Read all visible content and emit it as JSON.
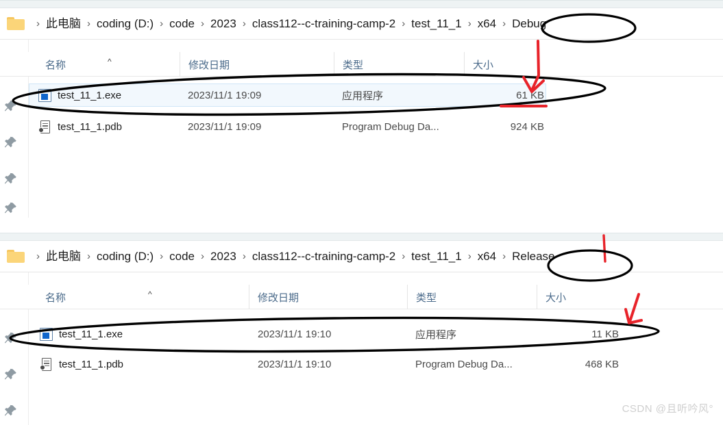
{
  "watermark": "CSDN @且听吟风°",
  "columns": {
    "name": "名称",
    "date": "修改日期",
    "type": "类型",
    "size": "大小"
  },
  "icons": {
    "folder": "folder-icon",
    "chevron": "chevron-right-icon",
    "sort_caret": "sort-ascending-caret-icon",
    "pin": "pin-icon",
    "exe": "application-exe-icon",
    "pdb": "program-debug-database-icon"
  },
  "colors": {
    "annotation_black": "#000000",
    "annotation_red": "#e8232a",
    "selection_blue": "#f2f8fd",
    "header_text": "#4a6a8a",
    "breadcrumb_text": "#1b1b1b"
  },
  "panels": [
    {
      "id": "debug-panel",
      "breadcrumb": {
        "separator": "›",
        "items": [
          "此电脑",
          "coding (D:)",
          "code",
          "2023",
          "class112--c-training-camp-2",
          "test_11_1",
          "x64",
          "Debug"
        ],
        "highlighted": "Debug"
      },
      "rows": [
        {
          "name": "test_11_1.exe",
          "date": "2023/11/1 19:09",
          "type": "应用程序",
          "size": "61 KB",
          "icon": "application-exe-icon",
          "selected": true,
          "annotated": true
        },
        {
          "name": "test_11_1.pdb",
          "date": "2023/11/1 19:09",
          "type": "Program Debug Da...",
          "size": "924 KB",
          "icon": "program-debug-database-icon",
          "selected": false,
          "annotated": false
        }
      ],
      "pin_count": 4
    },
    {
      "id": "release-panel",
      "breadcrumb": {
        "separator": "›",
        "items": [
          "此电脑",
          "coding (D:)",
          "code",
          "2023",
          "class112--c-training-camp-2",
          "test_11_1",
          "x64",
          "Release"
        ],
        "highlighted": "Release"
      },
      "rows": [
        {
          "name": "test_11_1.exe",
          "date": "2023/11/1 19:10",
          "type": "应用程序",
          "size": "11 KB",
          "icon": "application-exe-icon",
          "selected": false,
          "annotated": true
        },
        {
          "name": "test_11_1.pdb",
          "date": "2023/11/1 19:10",
          "type": "Program Debug Da...",
          "size": "468 KB",
          "icon": "program-debug-database-icon",
          "selected": false,
          "annotated": false
        }
      ],
      "pin_count": 3
    }
  ]
}
